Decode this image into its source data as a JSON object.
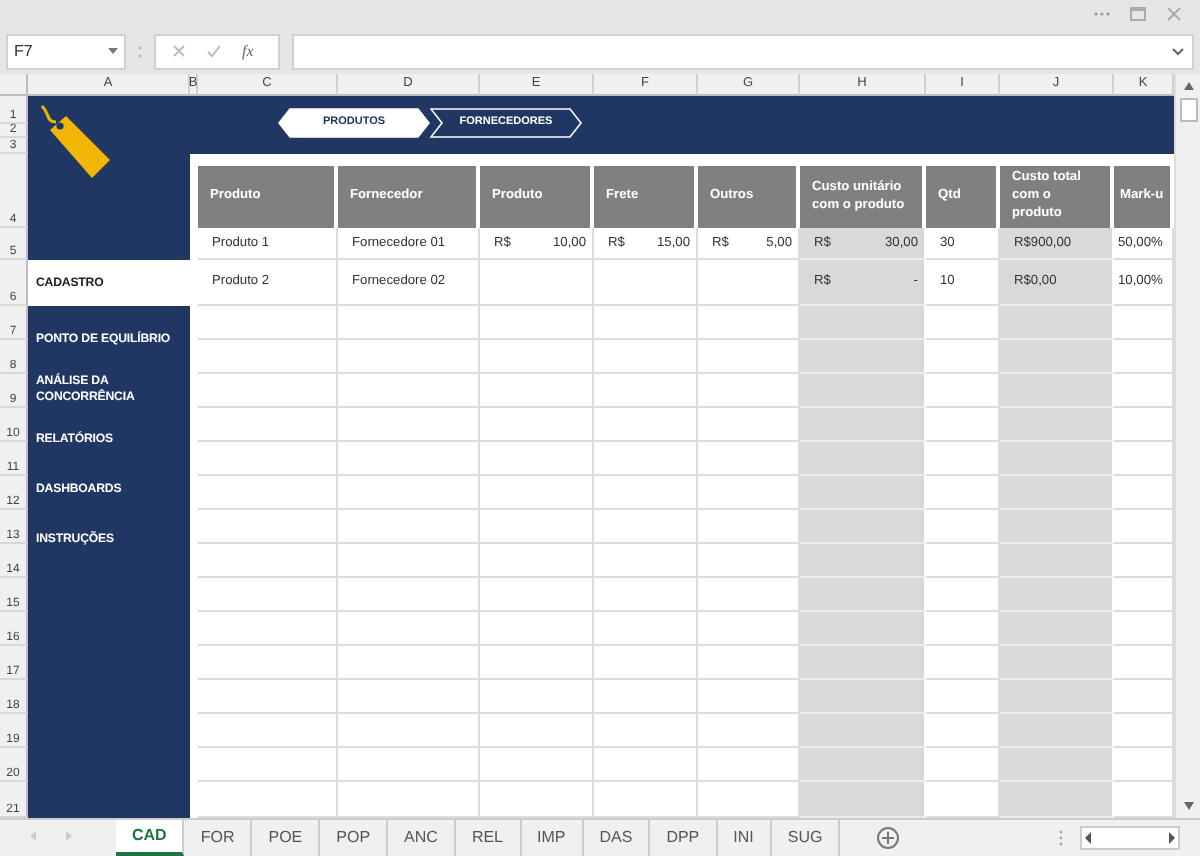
{
  "name_box": {
    "value": "F7"
  },
  "formula_bar": {
    "fx_label": "fx"
  },
  "columns": [
    "A",
    "B",
    "C",
    "D",
    "E",
    "F",
    "G",
    "H",
    "I",
    "J",
    "K"
  ],
  "rows": [
    "1",
    "2",
    "3",
    "4",
    "5",
    "6",
    "7",
    "8",
    "9",
    "10",
    "11",
    "12",
    "13",
    "14",
    "15",
    "16",
    "17",
    "18",
    "19",
    "20",
    "21"
  ],
  "banner_tabs": [
    {
      "label": "PRODUTOS",
      "selected": true
    },
    {
      "label": "FORNECEDORES",
      "selected": false
    }
  ],
  "sidebar": {
    "items": [
      {
        "label": "CADASTRO",
        "selected": true
      },
      {
        "label": "PONTO DE EQUILÍBRIO",
        "selected": false
      },
      {
        "label": "ANÁLISE DA CONCORRÊNCIA",
        "selected": false
      },
      {
        "label": "RELATÓRIOS",
        "selected": false
      },
      {
        "label": "DASHBOARDS",
        "selected": false
      },
      {
        "label": "INSTRUÇÕES",
        "selected": false
      }
    ]
  },
  "table": {
    "columns": [
      "Produto",
      "Fornecedor",
      "Produto",
      "Frete",
      "Outros",
      "Custo unitário com o produto",
      "Qtd",
      "Custo total com o produto",
      "Mark-u"
    ],
    "rows": [
      [
        "Produto 1",
        "Fornecedore 01",
        [
          "R$",
          "10,00"
        ],
        [
          "R$",
          "15,00"
        ],
        [
          "R$",
          "5,00"
        ],
        [
          "R$",
          "30,00"
        ],
        "30",
        "R$900,00",
        "50,00%"
      ],
      [
        "Produto 2",
        "Fornecedore 02",
        null,
        null,
        null,
        [
          "R$",
          "-"
        ],
        "10",
        "R$0,00",
        "10,00%"
      ]
    ]
  },
  "sheet_tabs": [
    {
      "label": "CAD",
      "selected": true
    },
    {
      "label": "FOR",
      "selected": false
    },
    {
      "label": "POE",
      "selected": false
    },
    {
      "label": "POP",
      "selected": false
    },
    {
      "label": "ANC",
      "selected": false
    },
    {
      "label": "REL",
      "selected": false
    },
    {
      "label": "IMP",
      "selected": false
    },
    {
      "label": "DAS",
      "selected": false
    },
    {
      "label": "DPP",
      "selected": false
    },
    {
      "label": "INI",
      "selected": false
    },
    {
      "label": "SUG",
      "selected": false
    }
  ]
}
